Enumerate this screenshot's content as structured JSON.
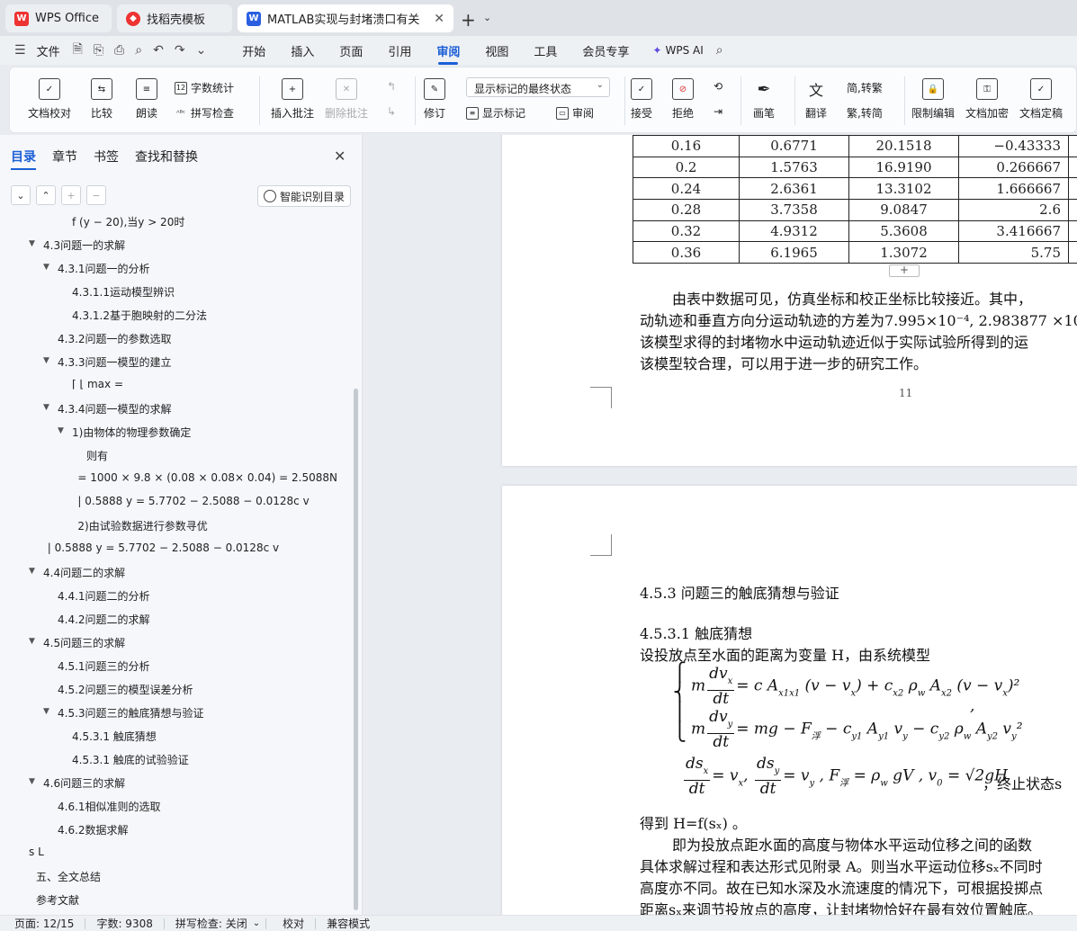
{
  "tabs": {
    "wps": "WPS Office",
    "template": "找稻壳模板",
    "doc": "MATLAB实现与封堵溃口有关"
  },
  "menubar": {
    "file": "文件",
    "tabs": [
      "开始",
      "插入",
      "页面",
      "引用",
      "审阅",
      "视图",
      "工具",
      "会员专享"
    ],
    "active_tab": "审阅",
    "wps_ai": "WPS AI"
  },
  "ribbon": {
    "doc_check": "文档校对",
    "compare": "比较",
    "read_aloud": "朗读",
    "word_count": "字数统计",
    "spell_check": "拼写检查",
    "insert_comment": "插入批注",
    "delete_comment": "删除批注",
    "revise": "修订",
    "markup_select": "显示标记的最终状态",
    "show_markup": "显示标记",
    "review": "审阅",
    "accept": "接受",
    "reject": "拒绝",
    "pen": "画笔",
    "translate": "翻译",
    "trad_to_simp": "简,转繁",
    "simp_to_trad": "繁,转简",
    "restrict_edit": "限制编辑",
    "doc_encrypt": "文档加密",
    "doc_finalize": "文档定稿"
  },
  "sidepanel": {
    "tabs": [
      "目录",
      "章节",
      "书签",
      "查找和替换"
    ],
    "active_tab": "目录",
    "smart_toc": "智能识别目录",
    "toc": [
      {
        "text": "f (y − 20),当y > 20时",
        "indent": 4,
        "caret": false
      },
      {
        "text": "4.3问题一的求解",
        "indent": 2,
        "caret": true
      },
      {
        "text": "4.3.1问题一的分析",
        "indent": 3,
        "caret": true
      },
      {
        "text": "4.3.1.1运动模型辨识",
        "indent": 4,
        "caret": false
      },
      {
        "text": "4.3.1.2基于胞映射的二分法",
        "indent": 4,
        "caret": false
      },
      {
        "text": "4.3.2问题一的参数选取",
        "indent": 3,
        "caret": false
      },
      {
        "text": "4.3.3问题一模型的建立",
        "indent": 3,
        "caret": true
      },
      {
        "text": "⌈ ⌊   max =",
        "indent": 4,
        "caret": false
      },
      {
        "text": "4.3.4问题一模型的求解",
        "indent": 3,
        "caret": true
      },
      {
        "text": "1)由物体的物理参数确定",
        "indent": 4,
        "caret": true
      },
      {
        "text": "则有",
        "indent": 5,
        "caret": false
      },
      {
        "text": "= 1000 × 9.8 × (0.08 × 0.08× 0.04) = 2.5088N",
        "indent": 4.4,
        "caret": false
      },
      {
        "text": "|  0.5888  y = 5.7702 − 2.5088 − 0.0128c v",
        "indent": 4.4,
        "caret": false
      },
      {
        "text": "2)由试验数据进行参数寻优",
        "indent": 4.4,
        "caret": false
      },
      {
        "text": "|  0.5888   y = 5.7702 − 2.5088 − 0.0128c v",
        "indent": 2.3,
        "caret": false
      },
      {
        "text": "4.4问题二的求解",
        "indent": 2,
        "caret": true
      },
      {
        "text": "4.4.1问题二的分析",
        "indent": 3,
        "caret": false
      },
      {
        "text": "4.4.2问题二的求解",
        "indent": 3,
        "caret": false
      },
      {
        "text": "4.5问题三的求解",
        "indent": 2,
        "caret": true
      },
      {
        "text": "4.5.1问题三的分析",
        "indent": 3,
        "caret": false
      },
      {
        "text": "4.5.2问题三的模型误差分析",
        "indent": 3,
        "caret": false
      },
      {
        "text": "4.5.3问题三的触底猜想与验证",
        "indent": 3,
        "caret": true
      },
      {
        "text": "4.5.3.1 触底猜想",
        "indent": 4,
        "caret": false
      },
      {
        "text": "4.5.3.1 触底的试验验证",
        "indent": 4,
        "caret": false
      },
      {
        "text": "4.6问题三的求解",
        "indent": 2,
        "caret": true
      },
      {
        "text": "4.6.1相似准则的选取",
        "indent": 3,
        "caret": false
      },
      {
        "text": "4.6.2数据求解",
        "indent": 3,
        "caret": false
      },
      {
        "text": "s L",
        "indent": 1,
        "caret": false
      },
      {
        "text": "五、全文总结",
        "indent": 1.5,
        "caret": false
      },
      {
        "text": "参考文献",
        "indent": 1.5,
        "caret": false
      }
    ]
  },
  "document": {
    "table": [
      [
        "0.16",
        "0.6771",
        "20.1518",
        "−0.43333"
      ],
      [
        "0.2",
        "1.5763",
        "16.9190",
        "0.266667"
      ],
      [
        "0.24",
        "2.6361",
        "13.3102",
        "1.666667"
      ],
      [
        "0.28",
        "3.7358",
        "9.0847",
        "2.6"
      ],
      [
        "0.32",
        "4.9312",
        "5.3608",
        "3.416667"
      ],
      [
        "0.36",
        "6.1965",
        "1.3072",
        "5.75"
      ]
    ],
    "page1_paragraph": [
      "由表中数据可见，仿真坐标和校正坐标比较接近。其中，",
      "动轨迹和垂直方向分运动轨迹的方差为7.995×10⁻⁴, 2.983877 ×10",
      "该模型求得的封堵物水中运动轨迹近似于实际试验所得到的运",
      "该模型较合理，可以用于进一步的研究工作。"
    ],
    "page_number": "11",
    "heading_453": "4.5.3 问题三的触底猜想与验证",
    "heading_4531": "4.5.3.1 触底猜想",
    "intro_line": "设投放点至水面的距离为变量 H，由系统模型",
    "result_line": "得到 H=f(sₓ) 。",
    "page2_paragraph": [
      "即为投放点距水面的高度与物体水平运动位移之间的函数",
      "具体求解过程和表达形式见附录 A。则当水平运动位移sₓ不同时",
      "高度亦不同。故在已知水深及水流速度的情况下，可根据投掷点",
      "距离sₓ来调节投放点的高度，让封堵物恰好在最有效位置触底。"
    ],
    "terminal_state": "，终止状态s"
  },
  "statusbar": {
    "page": "页面: 12/15",
    "words": "字数: 9308",
    "spell": "拼写检查: 关闭",
    "proof": "校对",
    "compat": "兼容模式"
  }
}
